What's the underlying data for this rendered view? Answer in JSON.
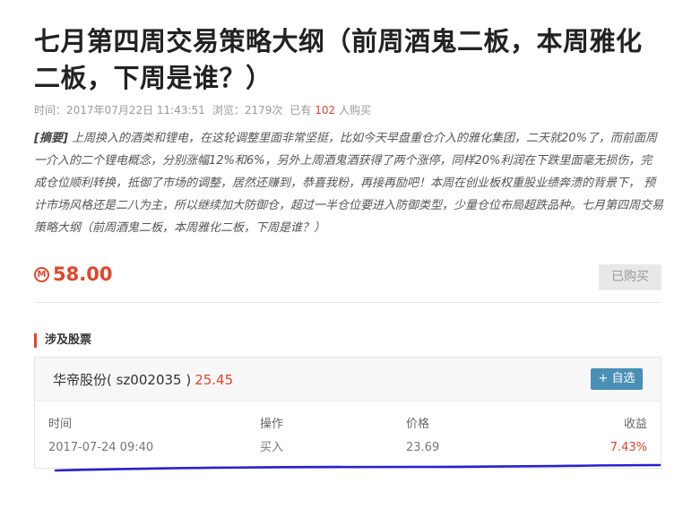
{
  "article": {
    "title": "七月第四周交易策略大纲（前周酒鬼二板，本周雅化二板，下周是谁？）",
    "meta": {
      "time_label": "时间：",
      "time_value": "2017年07月22日 11:43:51",
      "views_label": "浏览：",
      "views_value": "2179次",
      "buyers_prefix": "已有",
      "buyers_count": "102",
      "buyers_suffix": "人购买"
    },
    "abstract": {
      "tag": "[摘要]",
      "text": "上周换入的酒类和锂电，在这轮调整里面非常坚挺，比如今天早盘重仓介入的雅化集团，二天就20%了，而前面周一介入的二个锂电概念，分别涨幅12%和6%，另外上周酒鬼酒获得了两个涨停，同样20%利润在下跌里面毫无损伤，完成仓位顺利转换，抵御了市场的调整，居然还赚到，恭喜我粉，再接再励吧！本周在创业板权重股业绩奔溃的背景下， 预计市场风格还是二八为主，所以继续加大防御仓，超过一半仓位要进入防御类型，少量仓位布局超跌品种。七月第四周交易策略大纲（前周酒鬼二板，本周雅化二板，下周是谁？）"
    }
  },
  "purchase": {
    "currency_icon": "M",
    "price": "58.00",
    "bought_label": "已购买"
  },
  "stocks_section": {
    "title": "涉及股票",
    "stock": {
      "name": "华帝股份( sz002035 )",
      "price": "25.45",
      "add_label": "+ 自选"
    },
    "table": {
      "headers": [
        "时间",
        "操作",
        "价格",
        "收益"
      ],
      "rows": [
        [
          "2017-07-24 09:40",
          "买入",
          "23.69",
          "7.43%"
        ]
      ]
    }
  },
  "colors": {
    "accent_red": "#e2452a",
    "button_blue": "#4a8fb5",
    "annotation_stroke": "#2a1fd0"
  }
}
